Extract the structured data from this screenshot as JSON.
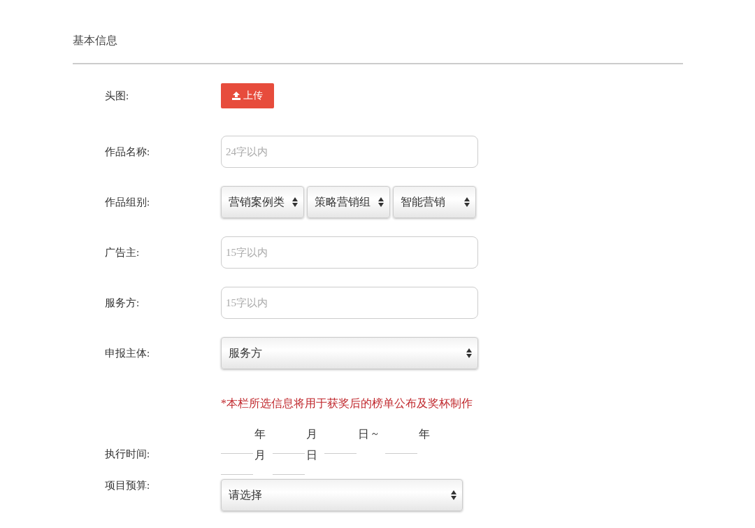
{
  "section_title": "基本信息",
  "fields": [
    {
      "kind": "upload",
      "label": "头图:",
      "button": "上传"
    },
    {
      "kind": "text",
      "label": "作品名称:",
      "placeholder": "24字以内"
    },
    {
      "kind": "selects",
      "label": "作品组别:",
      "values": [
        "营销案例类",
        "策略营销组",
        "智能营销"
      ]
    },
    {
      "kind": "text",
      "label": "广告主:",
      "placeholder": "15字以内"
    },
    {
      "kind": "text",
      "label": "服务方:",
      "placeholder": "15字以内"
    },
    {
      "kind": "select",
      "label": "申报主体:",
      "value": "服务方"
    },
    {
      "kind": "note",
      "text": "*本栏所选信息将用于获奖后的榜单公布及奖杯制作"
    },
    {
      "kind": "date",
      "label": "执行时间:",
      "units": [
        "年",
        "月",
        "日 ~",
        "年",
        "月",
        "日"
      ]
    },
    {
      "kind": "select",
      "label": "项目预算:",
      "value": "请选择"
    }
  ]
}
